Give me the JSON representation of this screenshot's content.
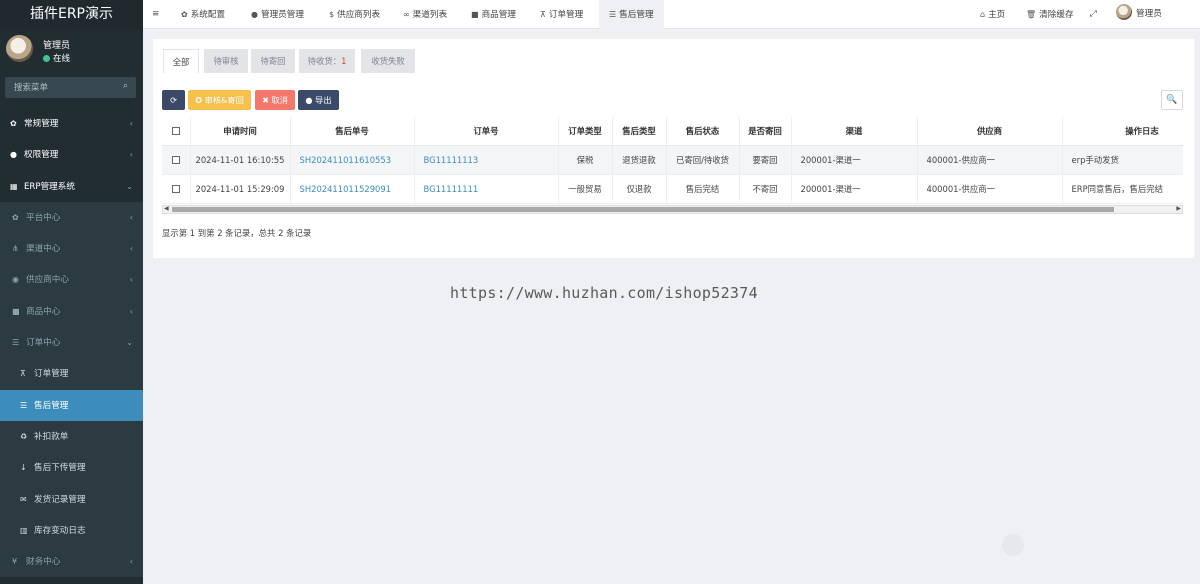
{
  "brand": "插件ERP演示",
  "user": {
    "name": "管理员",
    "status": "在线"
  },
  "search": {
    "placeholder": "搜索菜单"
  },
  "menu": [
    {
      "label": "常规管理",
      "icon": "cogs-icon",
      "level": "top",
      "arrow": "‹"
    },
    {
      "label": "权限管理",
      "icon": "group-icon",
      "level": "top",
      "arrow": "‹"
    },
    {
      "label": "ERP管理系统",
      "icon": "table-icon",
      "level": "top",
      "arrow": "⌄"
    },
    {
      "label": "平台中心",
      "icon": "gear-icon",
      "level": "sub",
      "arrow": "‹"
    },
    {
      "label": "渠道中心",
      "icon": "sitemap-icon",
      "level": "sub",
      "arrow": "‹"
    },
    {
      "label": "供应商中心",
      "icon": "globe-icon",
      "level": "sub",
      "arrow": "‹"
    },
    {
      "label": "商品中心",
      "icon": "cube-icon",
      "level": "sub",
      "arrow": "‹"
    },
    {
      "label": "订单中心",
      "icon": "list-icon",
      "level": "sub",
      "arrow": "⌄"
    },
    {
      "label": "订单管理",
      "icon": "cart-icon",
      "level": "sub2",
      "arrow": ""
    },
    {
      "label": "售后管理",
      "icon": "list-icon",
      "level": "sub2",
      "arrow": "",
      "active": true
    },
    {
      "label": "补扣款单",
      "icon": "recycle-icon",
      "level": "sub2",
      "arrow": ""
    },
    {
      "label": "售后下传管理",
      "icon": "arrow-down-icon",
      "level": "sub2",
      "arrow": ""
    },
    {
      "label": "发货记录管理",
      "icon": "envelope-icon",
      "level": "sub2",
      "arrow": ""
    },
    {
      "label": "库存变动日志",
      "icon": "bar-chart-icon",
      "level": "sub2",
      "arrow": ""
    },
    {
      "label": "财务中心",
      "icon": "yen-icon",
      "level": "sub",
      "arrow": "‹"
    }
  ],
  "topnav": {
    "menu_toggle": "≡",
    "tabs": [
      {
        "label": "系统配置",
        "icon": "gear-icon"
      },
      {
        "label": "管理员管理",
        "icon": "user-icon"
      },
      {
        "label": "供应商列表",
        "icon": "dollar-icon"
      },
      {
        "label": "渠道列表",
        "icon": "link-icon"
      },
      {
        "label": "商品管理",
        "icon": "cube-icon"
      },
      {
        "label": "订单管理",
        "icon": "cart-icon"
      },
      {
        "label": "售后管理",
        "icon": "list-icon",
        "active": true
      }
    ],
    "home": "主页",
    "clear_cache": "清除缓存",
    "fullscreen": "⤢",
    "admin": "管理员"
  },
  "filter_tabs": [
    {
      "label": "全部",
      "active": true
    },
    {
      "label": "待审核"
    },
    {
      "label": "待寄回"
    },
    {
      "label": "待收货：",
      "badge": "1"
    },
    {
      "label": "收货失败"
    }
  ],
  "toolbar": {
    "refresh": "⟳",
    "audit": "审核&寄回",
    "cancel": "取消",
    "export": "导出",
    "search": "🔍"
  },
  "table": {
    "columns": [
      "",
      "申请时间",
      "售后单号",
      "订单号",
      "订单类型",
      "售后类型",
      "售后状态",
      "是否寄回",
      "渠道",
      "供应商",
      "操作日志"
    ],
    "rows": [
      [
        "",
        "2024-11-01 16:10:55",
        "SH202411011610553",
        "BG11111113",
        "保税",
        "退货退款",
        "已寄回/待收货",
        "要寄回",
        "200001-渠道一",
        "400001-供应商一",
        "erp手动发货"
      ],
      [
        "",
        "2024-11-01 15:29:09",
        "SH202411011529091",
        "BG11111111",
        "一般贸易",
        "仅退款",
        "售后完结",
        "不寄回",
        "200001-渠道一",
        "400001-供应商一",
        "ERP同意售后，售后完结"
      ]
    ]
  },
  "summary": "显示第 1 到第 2 条记录，总共 2 条记录",
  "watermark_url": "https://www.huzhan.com/ishop52374"
}
